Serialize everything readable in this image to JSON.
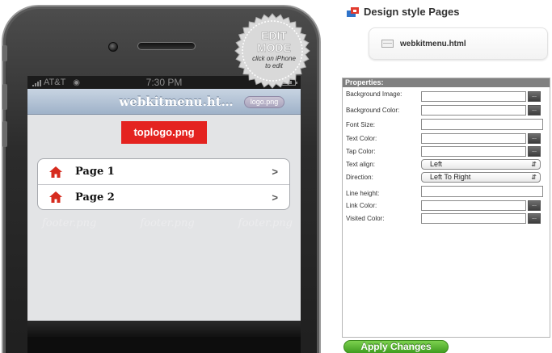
{
  "phone": {
    "status": {
      "carrier": "AT&T",
      "time": "7:30 PM"
    },
    "nav": {
      "title": "webkitmenu.ht…",
      "logo_label": "logo.png"
    },
    "toplogo": "toplogo.png",
    "menu": [
      {
        "label": "Page 1",
        "icon": "home-icon"
      },
      {
        "label": "Page 2",
        "icon": "home-icon"
      }
    ],
    "footer": [
      "footer.png",
      "footer.png",
      "footer.png"
    ],
    "edit_badge": {
      "title_line1": "EDIT",
      "title_line2": "MODE",
      "sub_line1": "click on iPhone",
      "sub_line2": "to edit"
    }
  },
  "panel": {
    "title": "Design style Pages",
    "file_name": "webkitmenu.html",
    "properties_header": "Properties:",
    "properties": [
      {
        "label": "Background Image:",
        "type": "color"
      },
      {
        "label": "Background Color:",
        "type": "color"
      },
      {
        "label": "Font Size:",
        "type": "text"
      },
      {
        "label": "Text Color:",
        "type": "color"
      },
      {
        "label": "Tap Color:",
        "type": "color"
      },
      {
        "label": "Text align:",
        "type": "select",
        "value": "Left"
      },
      {
        "label": "Direction:",
        "type": "select",
        "value": "Left To Right"
      },
      {
        "label": "Line height:",
        "type": "text"
      },
      {
        "label": "Link Color:",
        "type": "color"
      },
      {
        "label": "Visited Color:",
        "type": "color"
      }
    ],
    "color_button_label": "...",
    "apply_label": "Apply Changes"
  },
  "colors": {
    "accent_red": "#e42320",
    "apply_green": "#4fae2a",
    "nav_blue": "#a9bbd0"
  }
}
